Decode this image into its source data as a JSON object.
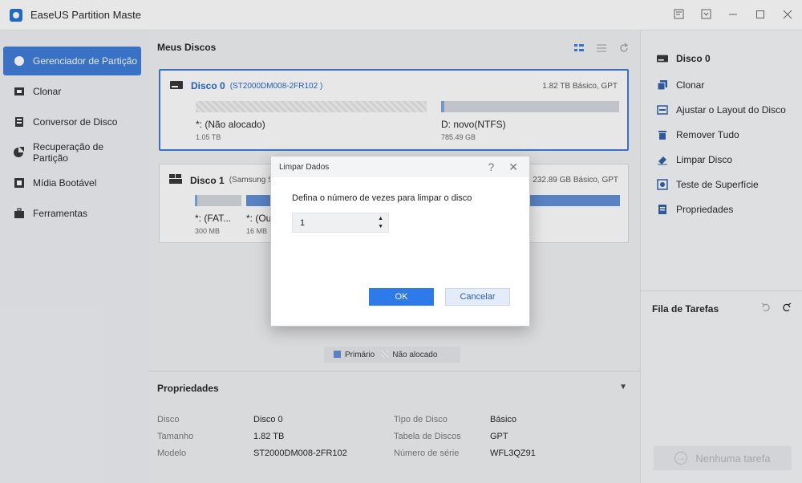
{
  "app": {
    "title": "EaseUS Partition Maste"
  },
  "sidebar": {
    "items": [
      {
        "label": "Gerenciador de Partição",
        "icon": "disk-manager-icon",
        "active": true
      },
      {
        "label": "Clonar",
        "icon": "clone-icon"
      },
      {
        "label": "Conversor de Disco",
        "icon": "disk-converter-icon"
      },
      {
        "label": "Recuperação de Partição",
        "icon": "partition-recovery-icon"
      },
      {
        "label": "Mídia Bootável",
        "icon": "bootable-media-icon"
      },
      {
        "label": "Ferramentas",
        "icon": "tools-icon"
      }
    ]
  },
  "main": {
    "header": "Meus Discos",
    "disks": [
      {
        "name": "Disco 0",
        "model": "(ST2000DM008-2FR102 )",
        "info": "1.82 TB Básico, GPT",
        "partitions": [
          {
            "name": "*: (Não alocado)",
            "size": "1.05 TB",
            "type": "unallocated"
          },
          {
            "name": "D: novo(NTFS)",
            "size": "785.49 GB",
            "type": "primary",
            "fill": 0.01
          }
        ]
      },
      {
        "name": "Disco 1",
        "model": "(Samsung SSD",
        "info": "232.89 GB Básico, GPT",
        "partitions": [
          {
            "name": "*: (FAT...",
            "size": "300 MB",
            "type": "primary",
            "fill": 0.05
          },
          {
            "name": "*: (Ou",
            "size": "16 MB",
            "type": "primary",
            "fill": 1.0
          }
        ]
      }
    ],
    "legend": {
      "primary": "Primário",
      "unallocated": "Não alocado"
    }
  },
  "properties": {
    "title": "Propriedades",
    "toggle": "▼",
    "rows": [
      {
        "label1": "Disco",
        "value1": "Disco 0",
        "label2": "Tipo de Disco",
        "value2": "Básico"
      },
      {
        "label1": "Tamanho",
        "value1": "1.82 TB",
        "label2": "Tabela de Discos",
        "value2": "GPT"
      },
      {
        "label1": "Modelo",
        "value1": "ST2000DM008-2FR102",
        "label2": "Número de série",
        "value2": "WFL3QZ91"
      }
    ]
  },
  "right_panel": {
    "disk_title": "Disco 0",
    "actions": [
      "Clonar",
      "Ajustar o Layout do Disco",
      "Remover Tudo",
      "Limpar Disco",
      "Teste de Superfície",
      "Propriedades"
    ],
    "task_queue": "Fila de Tarefas",
    "no_task": "Nenhuma tarefa"
  },
  "dialog": {
    "title": "Limpar Dados",
    "prompt": "Defina o número de vezes para limpar o disco",
    "value": "1",
    "ok": "OK",
    "cancel": "Cancelar"
  },
  "colors": {
    "accent": "#3a7ad9",
    "primary_partition": "#7ea6e0"
  }
}
